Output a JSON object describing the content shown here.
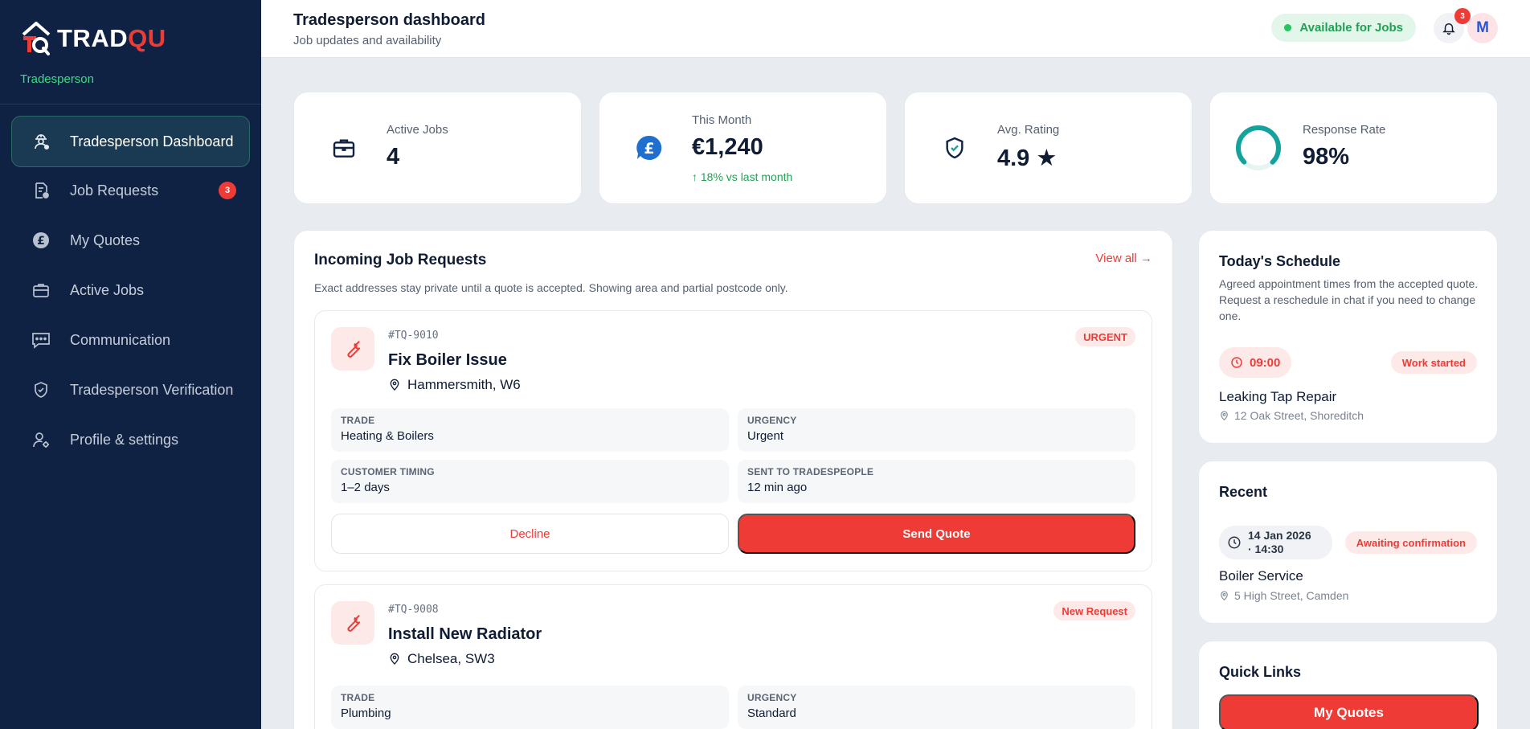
{
  "brand": {
    "name_white": "TRADQU",
    "name_white_part": "TRAD",
    "name_red_part": "QU",
    "role": "Tradesperson"
  },
  "sidebar": {
    "items": [
      {
        "label": "Tradesperson Dashboard",
        "icon": "worker-icon",
        "active": true
      },
      {
        "label": "Job Requests",
        "icon": "document-icon",
        "badge": "3"
      },
      {
        "label": "My Quotes",
        "icon": "pound-icon"
      },
      {
        "label": "Active Jobs",
        "icon": "briefcase-icon"
      },
      {
        "label": "Communication",
        "icon": "chat-icon"
      },
      {
        "label": "Tradesperson Verification",
        "icon": "shield-icon"
      },
      {
        "label": "Profile & settings",
        "icon": "user-settings-icon"
      }
    ]
  },
  "header": {
    "title": "Tradesperson dashboard",
    "subtitle": "Job updates and availability",
    "availability": "Available for Jobs",
    "notifications": "3",
    "avatar_initial": "M"
  },
  "stats": [
    {
      "label": "Active Jobs",
      "value": "4",
      "icon": "briefcase-icon"
    },
    {
      "label": "This Month",
      "value": "€1,240",
      "trend": "↑ 18% vs last month",
      "icon": "pound-badge-icon"
    },
    {
      "label": "Avg. Rating",
      "value": "4.9 ★",
      "icon": "shield-check-icon"
    },
    {
      "label": "Response Rate",
      "value": "98%",
      "icon": "progress-ring-icon",
      "progress": 0.98
    }
  ],
  "requests": {
    "title": "Incoming Job Requests",
    "view_all": "View all →",
    "note": "Exact addresses stay private until a quote is accepted. Showing area and partial postcode only.",
    "jobs": [
      {
        "id": "#TQ-9010",
        "title": "Fix Boiler Issue",
        "location": "Hammersmith, W6",
        "tag": "URGENT",
        "trade_label": "TRADE",
        "trade": "Heating & Boilers",
        "urgency_label": "URGENCY",
        "urgency": "Urgent",
        "timing_label": "CUSTOMER TIMING",
        "timing": "1–2 days",
        "sent_label": "SENT TO TRADESPEOPLE",
        "sent": "12 min ago",
        "decline": "Decline",
        "quote": "Send Quote"
      },
      {
        "id": "#TQ-9008",
        "title": "Install New Radiator",
        "location": "Chelsea, SW3",
        "tag": "New Request",
        "trade_label": "TRADE",
        "trade": "Plumbing",
        "urgency_label": "URGENCY",
        "urgency": "Standard"
      }
    ]
  },
  "schedule": {
    "title": "Today's Schedule",
    "desc": "Agreed appointment times from the accepted quote. Request a reschedule in chat if you need to change one.",
    "time": "09:00",
    "status": "Work started",
    "job": "Leaking Tap Repair",
    "address": "12 Oak Street, Shoreditch"
  },
  "recent": {
    "title": "Recent",
    "date_line1": "14 Jan 2026",
    "date_line2": "· 14:30",
    "status": "Awaiting confirmation",
    "job": "Boiler Service",
    "address": "5 High Street, Camden"
  },
  "quick_links": {
    "title": "Quick Links",
    "first": "My Quotes"
  },
  "colors": {
    "sidebar": "#0f2244",
    "accent": "#ef3b36",
    "success": "#22a156"
  }
}
